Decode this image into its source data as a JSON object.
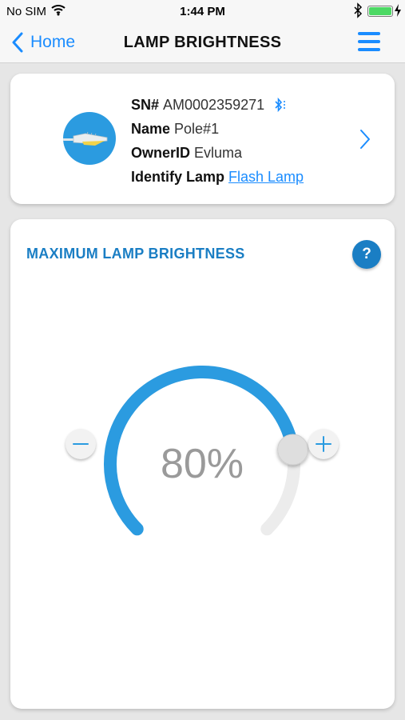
{
  "status_bar": {
    "carrier": "No SIM",
    "time": "1:44 PM",
    "battery_color": "#4cd964"
  },
  "nav": {
    "back_label": "Home",
    "title": "LAMP BRIGHTNESS"
  },
  "lamp_info": {
    "sn_label": "SN#",
    "sn_value": "AM0002359271",
    "name_label": "Name",
    "name_value": "Pole#1",
    "owner_label": "OwnerID",
    "owner_value": "Evluma",
    "identify_label": "Identify Lamp",
    "identify_link": "Flash Lamp"
  },
  "brightness": {
    "section_title": "MAXIMUM LAMP BRIGHTNESS",
    "help_label": "?",
    "value_text": "80%",
    "level": 0.8,
    "accent_color": "#2b9be0"
  },
  "icons": [
    "wifi-icon",
    "bluetooth-icon",
    "battery-icon",
    "chevron-left-icon",
    "menu-icon",
    "lamp-icon",
    "chevron-right-icon",
    "minus-icon",
    "plus-icon"
  ]
}
